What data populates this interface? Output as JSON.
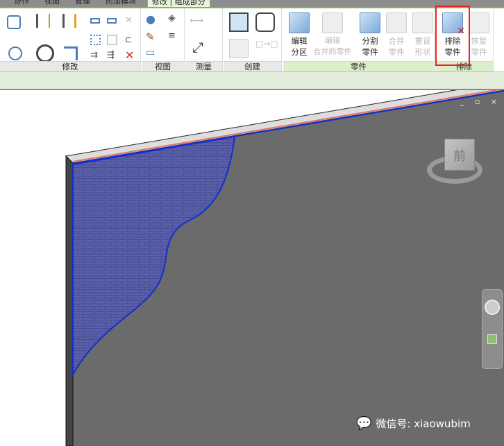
{
  "tabs": [
    "协作",
    "视图",
    "管理",
    "附加模块",
    "修改 | 组成部分"
  ],
  "panels": {
    "modify": "修改",
    "view": "视图",
    "measure": "测量",
    "create": "创建",
    "parts": "零件",
    "exclude": "排除"
  },
  "parts_buttons": [
    {
      "label1": "编辑",
      "label2": "分区",
      "enabled": true
    },
    {
      "label1": "编辑",
      "label2": "合并的零件",
      "enabled": false
    },
    {
      "label1": "分割",
      "label2": "零件",
      "enabled": true
    },
    {
      "label1": "合并",
      "label2": "零件",
      "enabled": false
    },
    {
      "label1": "重设",
      "label2": "形状",
      "enabled": false
    }
  ],
  "exclude_buttons": [
    {
      "label1": "排除",
      "label2": "零件",
      "enabled": true
    },
    {
      "label1": "恢复",
      "label2": "零件",
      "enabled": false
    }
  ],
  "viewcube": {
    "face": "前"
  },
  "window_controls": "_ ▫ ×",
  "watermark": "微信号: xiaowubim",
  "colors": {
    "accent": "#7ac142",
    "highlight": "#f02020",
    "part": "#5a5fa8",
    "viewport": "#6b6b6b"
  }
}
